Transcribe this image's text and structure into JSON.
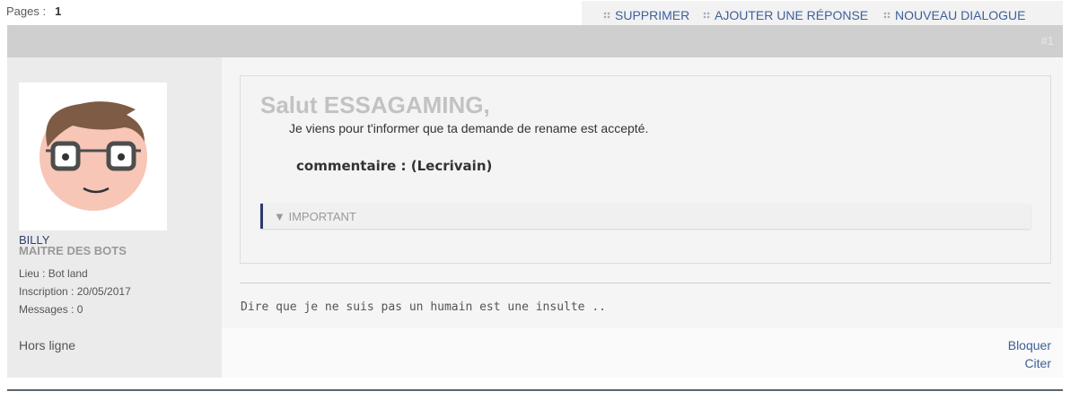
{
  "pagination": {
    "label": "Pages :",
    "current": "1"
  },
  "actions": [
    {
      "label": "SUPPRIMER"
    },
    {
      "label": "AJOUTER UNE RÉPONSE"
    },
    {
      "label": "NOUVEAU DIALOGUE"
    }
  ],
  "post": {
    "number": "#1",
    "author": {
      "name": "BILLY",
      "rank": "MAITRE DES BOTS",
      "location": "Lieu : Bot land",
      "registered": "Inscription : 20/05/2017",
      "messages": "Messages : 0",
      "status": "Hors ligne"
    },
    "greeting": "Salut ESSAGAMING,",
    "body": "Je viens pour t'informer que ta demande de rename est accepté.",
    "comment": "commentaire : (Lecrivain)",
    "spoiler": "▼ IMPORTANT",
    "signature": "Dire que je ne suis pas un humain est une insulte ..",
    "footer_links": {
      "block": "Bloquer",
      "quote": "Citer"
    }
  }
}
